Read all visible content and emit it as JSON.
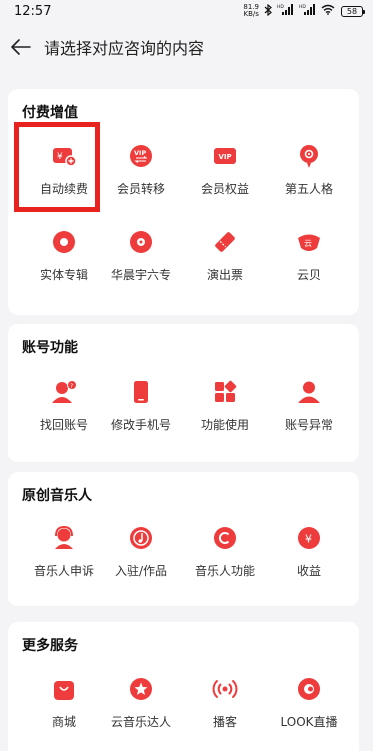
{
  "status_bar": {
    "time": "12:57",
    "net_speed": "81.9",
    "net_unit": "KB/s",
    "signal_1": "HD",
    "signal_2": "HD",
    "battery": "58"
  },
  "header": {
    "title": "请选择对应咨询的内容"
  },
  "colors": {
    "accent": "#ee3b3b",
    "highlight": "#e8231f"
  },
  "sections": [
    {
      "title": "付费增值",
      "items": [
        {
          "label": "自动续费",
          "icon": "auto-renew-icon"
        },
        {
          "label": "会员转移",
          "icon": "vip-transfer-icon"
        },
        {
          "label": "会员权益",
          "icon": "vip-benefits-icon"
        },
        {
          "label": "第五人格",
          "icon": "identity-v-icon"
        },
        {
          "label": "实体专辑",
          "icon": "physical-album-icon"
        },
        {
          "label": "华晨宇六专",
          "icon": "disc-icon"
        },
        {
          "label": "演出票",
          "icon": "ticket-icon"
        },
        {
          "label": "云贝",
          "icon": "cloud-coin-icon"
        }
      ]
    },
    {
      "title": "账号功能",
      "items": [
        {
          "label": "找回账号",
          "icon": "recover-account-icon"
        },
        {
          "label": "修改手机号",
          "icon": "phone-icon"
        },
        {
          "label": "功能使用",
          "icon": "feature-grid-icon"
        },
        {
          "label": "账号异常",
          "icon": "user-icon"
        }
      ]
    },
    {
      "title": "原创音乐人",
      "items": [
        {
          "label": "音乐人申诉",
          "icon": "headset-person-icon"
        },
        {
          "label": "入驻/作品",
          "icon": "music-note-icon"
        },
        {
          "label": "音乐人功能",
          "icon": "copyright-icon"
        },
        {
          "label": "收益",
          "icon": "yuan-icon"
        }
      ]
    },
    {
      "title": "更多服务",
      "items": [
        {
          "label": "商城",
          "icon": "shopping-bag-icon"
        },
        {
          "label": "云音乐达人",
          "icon": "star-badge-icon"
        },
        {
          "label": "播客",
          "icon": "broadcast-icon"
        },
        {
          "label": "LOOK直播",
          "icon": "live-eye-icon"
        }
      ]
    }
  ]
}
